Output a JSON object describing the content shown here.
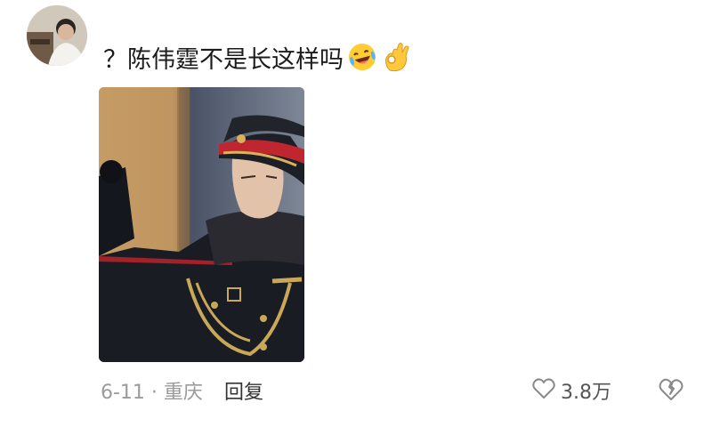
{
  "comment": {
    "text": "？陈伟霆不是长这样吗",
    "emojis": [
      "laughing-crying-icon",
      "ok-hand-icon"
    ],
    "image_alt": "photo"
  },
  "meta": {
    "date_location": "6-11 · 重庆",
    "reply_label": "回复"
  },
  "actions": {
    "like_icon": "heart-outline-icon",
    "like_count": "3.8万",
    "dislike_icon": "broken-heart-icon"
  },
  "colors": {
    "muted_text": "#9b9b9b",
    "main_text": "#1c1c1c",
    "icon_gray": "#8a8a8a"
  }
}
